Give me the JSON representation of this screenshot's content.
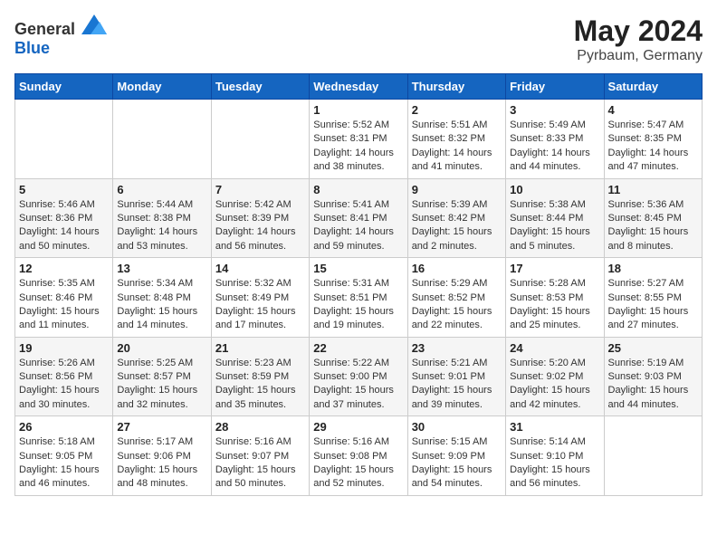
{
  "header": {
    "logo_general": "General",
    "logo_blue": "Blue",
    "month": "May 2024",
    "location": "Pyrbaum, Germany"
  },
  "calendar": {
    "days_of_week": [
      "Sunday",
      "Monday",
      "Tuesday",
      "Wednesday",
      "Thursday",
      "Friday",
      "Saturday"
    ],
    "weeks": [
      [
        {
          "day": "",
          "sunrise": "",
          "sunset": "",
          "daylight": ""
        },
        {
          "day": "",
          "sunrise": "",
          "sunset": "",
          "daylight": ""
        },
        {
          "day": "",
          "sunrise": "",
          "sunset": "",
          "daylight": ""
        },
        {
          "day": "1",
          "sunrise": "Sunrise: 5:52 AM",
          "sunset": "Sunset: 8:31 PM",
          "daylight": "Daylight: 14 hours and 38 minutes."
        },
        {
          "day": "2",
          "sunrise": "Sunrise: 5:51 AM",
          "sunset": "Sunset: 8:32 PM",
          "daylight": "Daylight: 14 hours and 41 minutes."
        },
        {
          "day": "3",
          "sunrise": "Sunrise: 5:49 AM",
          "sunset": "Sunset: 8:33 PM",
          "daylight": "Daylight: 14 hours and 44 minutes."
        },
        {
          "day": "4",
          "sunrise": "Sunrise: 5:47 AM",
          "sunset": "Sunset: 8:35 PM",
          "daylight": "Daylight: 14 hours and 47 minutes."
        }
      ],
      [
        {
          "day": "5",
          "sunrise": "Sunrise: 5:46 AM",
          "sunset": "Sunset: 8:36 PM",
          "daylight": "Daylight: 14 hours and 50 minutes."
        },
        {
          "day": "6",
          "sunrise": "Sunrise: 5:44 AM",
          "sunset": "Sunset: 8:38 PM",
          "daylight": "Daylight: 14 hours and 53 minutes."
        },
        {
          "day": "7",
          "sunrise": "Sunrise: 5:42 AM",
          "sunset": "Sunset: 8:39 PM",
          "daylight": "Daylight: 14 hours and 56 minutes."
        },
        {
          "day": "8",
          "sunrise": "Sunrise: 5:41 AM",
          "sunset": "Sunset: 8:41 PM",
          "daylight": "Daylight: 14 hours and 59 minutes."
        },
        {
          "day": "9",
          "sunrise": "Sunrise: 5:39 AM",
          "sunset": "Sunset: 8:42 PM",
          "daylight": "Daylight: 15 hours and 2 minutes."
        },
        {
          "day": "10",
          "sunrise": "Sunrise: 5:38 AM",
          "sunset": "Sunset: 8:44 PM",
          "daylight": "Daylight: 15 hours and 5 minutes."
        },
        {
          "day": "11",
          "sunrise": "Sunrise: 5:36 AM",
          "sunset": "Sunset: 8:45 PM",
          "daylight": "Daylight: 15 hours and 8 minutes."
        }
      ],
      [
        {
          "day": "12",
          "sunrise": "Sunrise: 5:35 AM",
          "sunset": "Sunset: 8:46 PM",
          "daylight": "Daylight: 15 hours and 11 minutes."
        },
        {
          "day": "13",
          "sunrise": "Sunrise: 5:34 AM",
          "sunset": "Sunset: 8:48 PM",
          "daylight": "Daylight: 15 hours and 14 minutes."
        },
        {
          "day": "14",
          "sunrise": "Sunrise: 5:32 AM",
          "sunset": "Sunset: 8:49 PM",
          "daylight": "Daylight: 15 hours and 17 minutes."
        },
        {
          "day": "15",
          "sunrise": "Sunrise: 5:31 AM",
          "sunset": "Sunset: 8:51 PM",
          "daylight": "Daylight: 15 hours and 19 minutes."
        },
        {
          "day": "16",
          "sunrise": "Sunrise: 5:29 AM",
          "sunset": "Sunset: 8:52 PM",
          "daylight": "Daylight: 15 hours and 22 minutes."
        },
        {
          "day": "17",
          "sunrise": "Sunrise: 5:28 AM",
          "sunset": "Sunset: 8:53 PM",
          "daylight": "Daylight: 15 hours and 25 minutes."
        },
        {
          "day": "18",
          "sunrise": "Sunrise: 5:27 AM",
          "sunset": "Sunset: 8:55 PM",
          "daylight": "Daylight: 15 hours and 27 minutes."
        }
      ],
      [
        {
          "day": "19",
          "sunrise": "Sunrise: 5:26 AM",
          "sunset": "Sunset: 8:56 PM",
          "daylight": "Daylight: 15 hours and 30 minutes."
        },
        {
          "day": "20",
          "sunrise": "Sunrise: 5:25 AM",
          "sunset": "Sunset: 8:57 PM",
          "daylight": "Daylight: 15 hours and 32 minutes."
        },
        {
          "day": "21",
          "sunrise": "Sunrise: 5:23 AM",
          "sunset": "Sunset: 8:59 PM",
          "daylight": "Daylight: 15 hours and 35 minutes."
        },
        {
          "day": "22",
          "sunrise": "Sunrise: 5:22 AM",
          "sunset": "Sunset: 9:00 PM",
          "daylight": "Daylight: 15 hours and 37 minutes."
        },
        {
          "day": "23",
          "sunrise": "Sunrise: 5:21 AM",
          "sunset": "Sunset: 9:01 PM",
          "daylight": "Daylight: 15 hours and 39 minutes."
        },
        {
          "day": "24",
          "sunrise": "Sunrise: 5:20 AM",
          "sunset": "Sunset: 9:02 PM",
          "daylight": "Daylight: 15 hours and 42 minutes."
        },
        {
          "day": "25",
          "sunrise": "Sunrise: 5:19 AM",
          "sunset": "Sunset: 9:03 PM",
          "daylight": "Daylight: 15 hours and 44 minutes."
        }
      ],
      [
        {
          "day": "26",
          "sunrise": "Sunrise: 5:18 AM",
          "sunset": "Sunset: 9:05 PM",
          "daylight": "Daylight: 15 hours and 46 minutes."
        },
        {
          "day": "27",
          "sunrise": "Sunrise: 5:17 AM",
          "sunset": "Sunset: 9:06 PM",
          "daylight": "Daylight: 15 hours and 48 minutes."
        },
        {
          "day": "28",
          "sunrise": "Sunrise: 5:16 AM",
          "sunset": "Sunset: 9:07 PM",
          "daylight": "Daylight: 15 hours and 50 minutes."
        },
        {
          "day": "29",
          "sunrise": "Sunrise: 5:16 AM",
          "sunset": "Sunset: 9:08 PM",
          "daylight": "Daylight: 15 hours and 52 minutes."
        },
        {
          "day": "30",
          "sunrise": "Sunrise: 5:15 AM",
          "sunset": "Sunset: 9:09 PM",
          "daylight": "Daylight: 15 hours and 54 minutes."
        },
        {
          "day": "31",
          "sunrise": "Sunrise: 5:14 AM",
          "sunset": "Sunset: 9:10 PM",
          "daylight": "Daylight: 15 hours and 56 minutes."
        },
        {
          "day": "",
          "sunrise": "",
          "sunset": "",
          "daylight": ""
        }
      ]
    ]
  }
}
